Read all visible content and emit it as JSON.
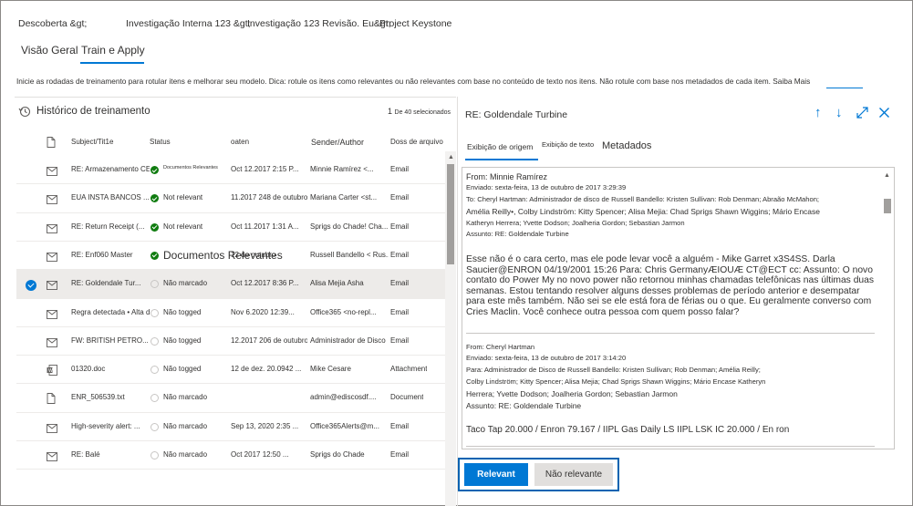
{
  "breadcrumb": {
    "items": [
      "Descoberta &gt;",
      "Investigação Interna 123 &gt;",
      "Investigação 123 Revisão. Eu&gt;",
      "Project Keystone"
    ]
  },
  "tabs": [
    {
      "label": "Visão Geral",
      "active": false
    },
    {
      "label": "Train e Apply",
      "active": true
    }
  ],
  "info": {
    "text": "Inicie as rodadas de treinamento para rotular itens e melhorar seu modelo. Dica: rotule os itens como relevantes ou não relevantes com base no conteúdo de texto nos itens. Não rotule com base nos metadados de cada item.",
    "link": "Saiba Mais"
  },
  "history": {
    "title": "Histórico de treinamento",
    "count": "1",
    "count_label": "De 40 selecionados"
  },
  "columns": {
    "subject": "Subject/Tit1e",
    "status": "Status",
    "date": "oaten",
    "sender": "Sender/Author",
    "type": "Doss de arquivo"
  },
  "rows": [
    {
      "icon": "mail-icon",
      "subject": "RE: Armazenamento CES",
      "status": "Documentos Relevantes",
      "status_kind": "relevant-small",
      "date": "Oct 12.2017 2:15 P...",
      "sender": "Minnie Ramírez    <...",
      "type": "Email"
    },
    {
      "icon": "mail-icon",
      "subject": "EUA INSTA BANCOS ...",
      "status": "Not relevant",
      "status_kind": "ok",
      "date": "11.2017 248 de outubro",
      "sender": "Mariana Carter    <st...",
      "type": "Email"
    },
    {
      "icon": "mail-icon",
      "subject": "RE: Return Receipt (...",
      "status": "Not relevant",
      "status_kind": "ok",
      "date": "Oct 11.2017 1:31    A...",
      "sender": "Sprigs do Chade! Cha...",
      "type": "Email"
    },
    {
      "icon": "mail-icon",
      "subject": "RE: Enf060 Master",
      "status": "Documentos Relevantes",
      "status_kind": "relevant-big",
      "date": "12 de outubro",
      "sender": "Russell Bandello < Rus...",
      "type": "Email"
    },
    {
      "icon": "mail-icon",
      "subject": "RE: Goldendale    Tur...",
      "status": "Não marcado",
      "status_kind": "none",
      "date": "Oct 12.2017 8:36 P...",
      "sender": "Alisa Mejia Asha",
      "type": "Email",
      "selected": true
    },
    {
      "icon": "mail-icon",
      "subject": "Regra detectada • Alta de RC...",
      "status": "Não togged",
      "status_kind": "none",
      "date": "Nov 6.2020 12:39...",
      "sender": "Office365 <no-repl...",
      "type": "Email"
    },
    {
      "icon": "mail-icon",
      "subject": "FW: BRITISH PETRO...",
      "status": "Não togged",
      "status_kind": "none",
      "date": "12.2017 206 de outubro",
      "sender": "Administrador de Disco",
      "type": "Email"
    },
    {
      "icon": "doc-icon",
      "subject": "01320.doc",
      "status": "Não togged",
      "status_kind": "none",
      "date": "12 de dez. 20.0942 ...",
      "sender": "Mike Cesare",
      "type": "Attachment"
    },
    {
      "icon": "file-icon",
      "subject": "ENR_506539.txt",
      "status": "Não marcado",
      "status_kind": "none",
      "date": "",
      "sender": "admin@ediscosdf....",
      "type": "Document"
    },
    {
      "icon": "mail-icon",
      "subject": "High-severity alert: ...",
      "status": "Não marcado",
      "status_kind": "none",
      "date": "Sep 13, 2020 2:35 ...",
      "sender": "Office365Alerts@m...",
      "type": "Email"
    },
    {
      "icon": "mail-icon",
      "subject": "RE: Balé",
      "status": "Não marcado",
      "status_kind": "none",
      "date": "Oct 2017      12:50 ...",
      "sender": "Sprigs do Chade",
      "type": "Email"
    }
  ],
  "preview": {
    "title": "RE: Goldendale Turbine",
    "tabs": [
      "Exibição de origem",
      "Exibição de texto",
      "Metadados"
    ],
    "header1": [
      "From: Minnie Ramírez",
      "Enviado: sexta-feira, 13 de outubro de 2017 3:29:39",
      "To: Cheryl Hartman: Administrador de disco de Russell Bandello: Kristen Sullivan: Rob Denman; Abraão McMahon;",
      "Amélia Reilly•, Colby Lindström: Kitty Spencer; Alisa Mejia: Chad Sprigs Shawn Wiggins; Mário Encase",
      "Katheryn Herrera; Yvette Dodson; Joalheria Gordon; Sebastian Jarmon",
      "Assunto: RE: Goldendale Turbine"
    ],
    "body1": "Esse não é o cara certo, mas ele pode levar você a alguém - Mike Garret x3S4SS. Darla Saucier@ENRON 04/19/2001 15:26 Para: Chris GermanyÆIOUÆ CT@ECT cc: Assunto: O novo contato do Power My no novo power não retornou minhas chamadas telefônicas nas últimas duas semanas. Estou tentando resolver alguns desses problemas de período anterior e desempatar para este mês também. Não sei se ele está fora de férias ou o que. Eu geralmente converso com Cries Maclin. Você conhece outra pessoa com quem posso falar?",
    "header2": [
      "From: Cheryl Hartman",
      "Enviado: sexta-feira, 13 de outubro de 2017 3:14:20",
      "Para: Administrador de Disco de Russell Bandello: Kristen Sullivan; Rob Denman; Amélia Reilly;",
      "Colby Lindström; Kitty Spencer; Alisa Mejia; Chad Sprigs Shawn Wiggins; Mário Encase Katheryn",
      "Herrera; Yvette Dodson; Joalheria Gordon; Sebastian Jarmon",
      "Assunto: RE: Goldendale Turbine"
    ],
    "body2": "Taco Tap 20.000 / Enron 79.167 / IIPL Gas Daily LS IIPL LSK IC 20.000 / En ron"
  },
  "buttons": {
    "relevant": "Relevant",
    "not_relevant": "Não relevante"
  },
  "colors": {
    "accent": "#0078d4",
    "success": "#107c10"
  }
}
